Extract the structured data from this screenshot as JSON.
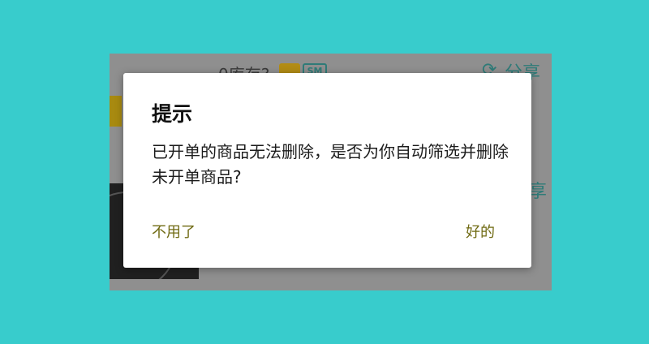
{
  "background": {
    "top_text": "0库存?",
    "badge_text": "SM",
    "share_label": "分享",
    "share_label_partial": "享"
  },
  "dialog": {
    "title": "提示",
    "message": "已开单的商品无法删除，是否为你自动筛选并删除未开单商品?",
    "cancel_label": "不用了",
    "confirm_label": "好的"
  },
  "colors": {
    "page_background": "#38cccc",
    "overlay": "#8f8f8f",
    "button_text": "#6f6a12",
    "accent_teal": "#2f7b78"
  }
}
